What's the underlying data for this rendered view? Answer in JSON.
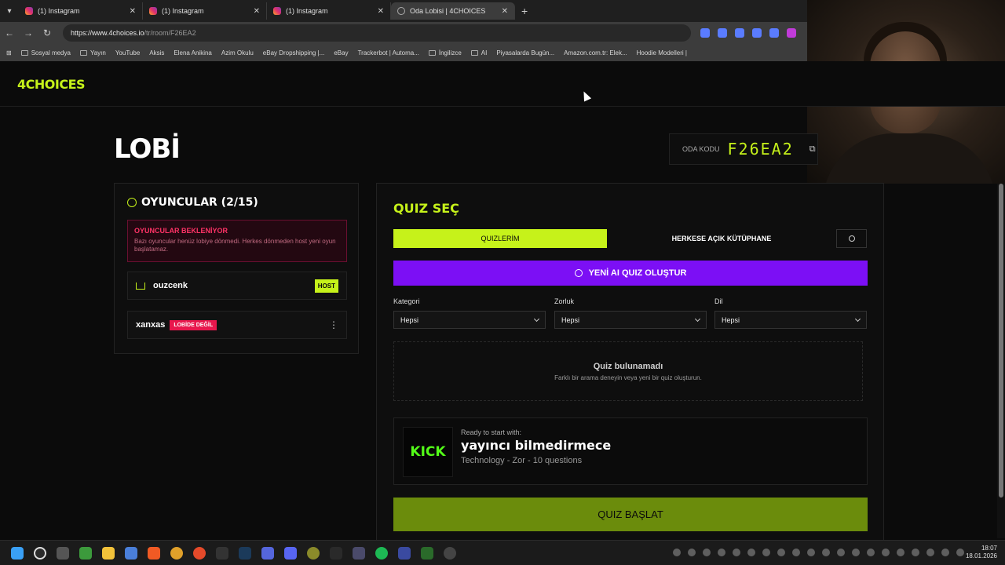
{
  "browser": {
    "tabs": [
      {
        "title": "(1) Instagram",
        "active": false
      },
      {
        "title": "(1) Instagram",
        "active": false
      },
      {
        "title": "(1) Instagram",
        "active": false
      },
      {
        "title": "Oda Lobisi | 4CHOICES",
        "active": true
      }
    ],
    "url_domain": "https://www.4choices.io",
    "url_path": "/tr/room/F26EA2",
    "bookmarks": [
      "Sosyal medya",
      "Yayın",
      "YouTube",
      "Aksis",
      "Elena Anikina",
      "Azim Okulu",
      "eBay Dropshipping |...",
      "eBay",
      "Trackerbot | Automa...",
      "İngilizce",
      "AI",
      "Piyasalarda Bugün...",
      "Amazon.com.tr: Elek...",
      "Hoodie Modelleri |"
    ]
  },
  "site": {
    "logo": "4CHOICES",
    "page_title": "LOBİ",
    "room_code_label": "ODA KODU",
    "room_code": "F26EA2"
  },
  "players": {
    "title": "OYUNCULAR (2/15)",
    "warning_title": "OYUNCULAR BEKLENİYOR",
    "warning_text": "Bazı oyuncular henüz lobiye dönmedi. Herkes dönmeden host yeni oyun başlatamaz.",
    "list": [
      {
        "name": "ouzcenk",
        "badge": "HOST"
      },
      {
        "name": "xanxas",
        "badge": "LOBİDE DEĞİL"
      }
    ]
  },
  "quiz": {
    "title": "QUIZ SEÇ",
    "tab_mine": "QUIZLERİM",
    "tab_public": "HERKESE AÇIK KÜTÜPHANE",
    "ai_button": "YENİ AI QUIZ OLUŞTUR",
    "filters": [
      {
        "label": "Kategori",
        "value": "Hepsi"
      },
      {
        "label": "Zorluk",
        "value": "Hepsi"
      },
      {
        "label": "Dil",
        "value": "Hepsi"
      }
    ],
    "empty_title": "Quiz bulunamadı",
    "empty_text": "Farklı bir arama deneyin veya yeni bir quiz oluşturun.",
    "ready_label": "Ready to start with:",
    "selected_name": "yayıncı bilmedirmece",
    "selected_meta": "Technology - Zor - 10 questions",
    "kick_logo": "KICK",
    "start_button": "QUIZ BAŞLAT"
  },
  "taskbar": {
    "time": "18:07",
    "date": "18.01.2026"
  },
  "colors": {
    "accent": "#c6f21a",
    "purple": "#7c0ff5",
    "danger": "#e8174d",
    "start_button": "#6b8c0c"
  }
}
